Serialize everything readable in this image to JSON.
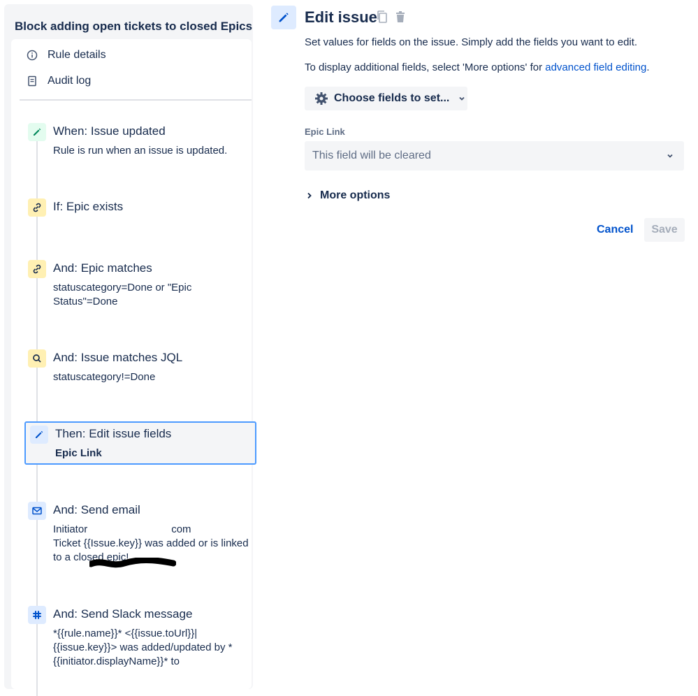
{
  "sidebar": {
    "rule_title": "Block adding open tickets to closed Epics",
    "links": [
      {
        "label": "Rule details",
        "icon": "info-icon"
      },
      {
        "label": "Audit log",
        "icon": "document-icon"
      }
    ],
    "steps": [
      {
        "title": "When: Issue updated",
        "desc": "Rule is run when an issue is updated.",
        "icon": "pencil-icon",
        "color": "#00875a"
      },
      {
        "title": "If: Epic exists",
        "desc": "",
        "icon": "link-icon",
        "color": "#ff991f"
      },
      {
        "title": "And: Epic matches",
        "desc": "statuscategory=Done or \"Epic Status\"=Done",
        "icon": "link-icon",
        "color": "#ff991f"
      },
      {
        "title": "And: Issue matches JQL",
        "desc": "statuscategory!=Done",
        "icon": "search-icon",
        "color": "#ff991f"
      },
      {
        "title": "Then: Edit issue fields",
        "desc": "Epic Link",
        "icon": "pencil-icon",
        "color": "#0052cc",
        "selected": true
      },
      {
        "title": "And: Send email",
        "desc_line1": "Initiator",
        "desc_line1_end": "com",
        "desc_rest": "Ticket {{Issue.key}} was added or is linked to a closed epic!",
        "icon": "mail-icon",
        "color": "#0052cc"
      },
      {
        "title": "And: Send Slack message",
        "desc": "*{{rule.name}}* <{{issue.toUrl}}|{{issue.key}}> was added/updated by *{{initiator.displayName}}* to",
        "icon": "slack-icon",
        "color": "#0052cc"
      }
    ]
  },
  "main": {
    "title": "Edit issue",
    "description_1": "Set values for fields on the issue. Simply add the fields you want to edit.",
    "description_2_prefix": "To display additional fields, select 'More options' for ",
    "description_2_link": "advanced field editing",
    "description_2_suffix": ".",
    "choose_fields_label": "Choose fields to set...",
    "field_label": "Epic Link",
    "field_value": "This field will be cleared",
    "more_options_label": "More options",
    "cancel_label": "Cancel",
    "save_label": "Save"
  },
  "colors": {
    "accent": "#0052cc",
    "text": "#172b4d",
    "subtle": "#5e6c84",
    "selection_border": "#4c9aff"
  }
}
